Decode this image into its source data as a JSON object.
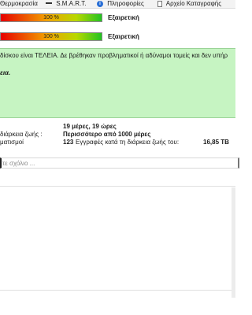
{
  "tabs": [
    {
      "label": "Θερμοκρασία",
      "icon": "thermometer-icon"
    },
    {
      "label": "S.M.A.R.T.",
      "icon": "smart-icon"
    },
    {
      "label": "Πληροφορίες",
      "icon": "info-icon"
    },
    {
      "label": "Αρχείο Καταγραφής",
      "icon": "log-file-icon"
    }
  ],
  "health": {
    "percent_label": "100 %",
    "percent": 100,
    "rating": "Εξαιρετική"
  },
  "performance": {
    "percent_label": "100 %",
    "percent": 100,
    "rating": "Εξαιρετική"
  },
  "status": {
    "text": "δίσκου είναι ΤΕΛΕΙΑ. Δε βρέθηκαν προβληματικοί ή αδύναμοι τομείς και δεν υπήρ",
    "extra": "εια.",
    "panel_color": "#c6f4c2"
  },
  "details": {
    "power_on_value": "19 μέρες, 19 ώρες",
    "lifetime_label": "διάρκεια ζωής :",
    "lifetime_value": "Περισσότερο από 1000 μέρες",
    "cycles_label": "ματισμοί",
    "cycles_value": "123",
    "writes_label": "Εγγραφές κατά τη διάρκεια ζωής του:",
    "writes_value": "16,85 TB"
  },
  "comment": {
    "placeholder": "τε σχόλιο ..."
  }
}
